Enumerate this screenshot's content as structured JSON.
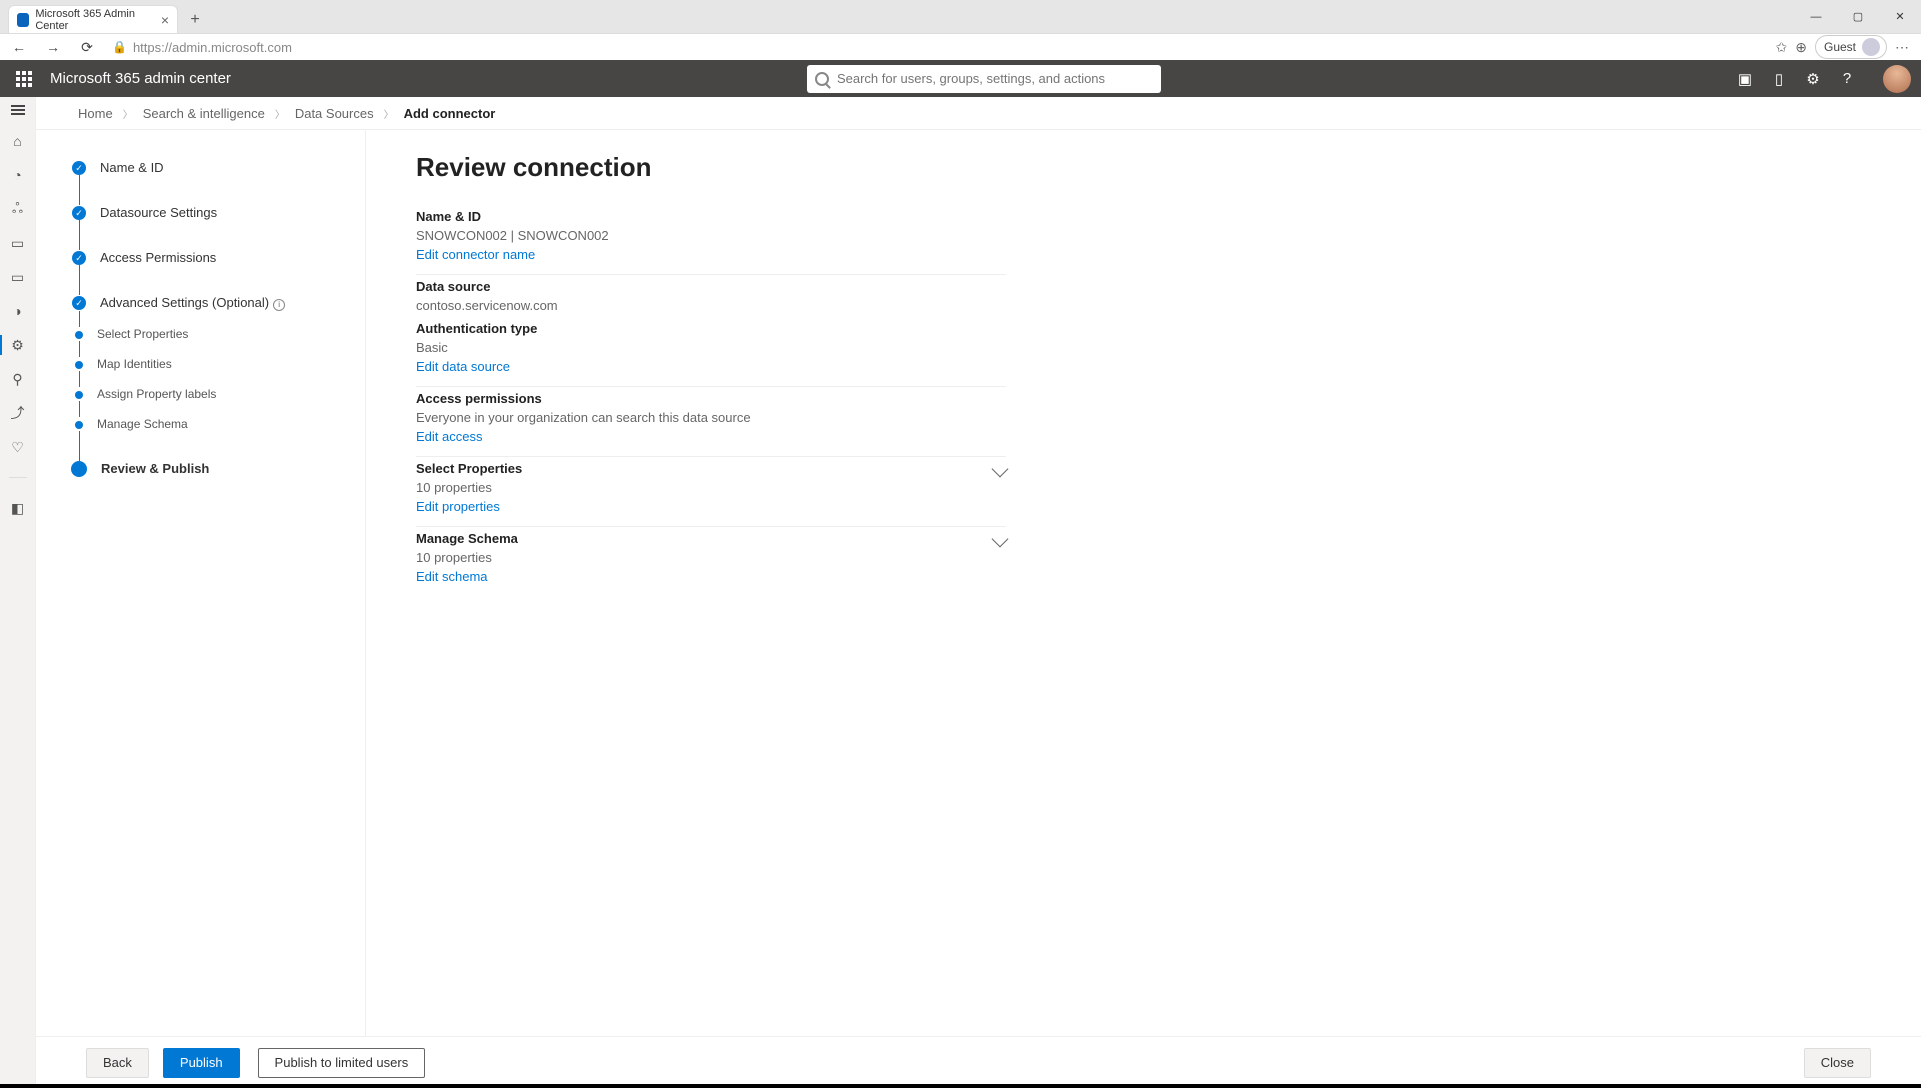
{
  "browser": {
    "tab_title": "Microsoft 365 Admin Center",
    "url": "https://admin.microsoft.com",
    "guest_label": "Guest"
  },
  "header": {
    "app_title": "Microsoft 365 admin center",
    "search_placeholder": "Search for users, groups, settings, and actions"
  },
  "breadcrumb": {
    "items": [
      "Home",
      "Search & intelligence",
      "Data Sources"
    ],
    "current": "Add connector"
  },
  "wizard": {
    "steps": [
      {
        "label": "Name & ID"
      },
      {
        "label": "Datasource Settings"
      },
      {
        "label": "Access Permissions"
      },
      {
        "label": "Advanced Settings (Optional)"
      },
      {
        "label": "Select Properties"
      },
      {
        "label": "Map Identities"
      },
      {
        "label": "Assign Property labels"
      },
      {
        "label": "Manage Schema"
      },
      {
        "label": "Review & Publish"
      }
    ]
  },
  "review": {
    "title": "Review connection",
    "name_id": {
      "heading": "Name & ID",
      "value": "SNOWCON002 | SNOWCON002",
      "link": "Edit connector name"
    },
    "data_source": {
      "heading": "Data source",
      "value": "contoso.servicenow.com",
      "auth_heading": "Authentication type",
      "auth_value": "Basic",
      "link": "Edit data source"
    },
    "access": {
      "heading": "Access permissions",
      "value": "Everyone in your organization can search this data source",
      "link": "Edit access"
    },
    "props": {
      "heading": "Select Properties",
      "value": "10 properties",
      "link": "Edit properties"
    },
    "schema": {
      "heading": "Manage Schema",
      "value": "10 properties",
      "link": "Edit schema"
    }
  },
  "footer": {
    "back": "Back",
    "publish": "Publish",
    "publish_limited": "Publish to limited users",
    "close": "Close"
  }
}
